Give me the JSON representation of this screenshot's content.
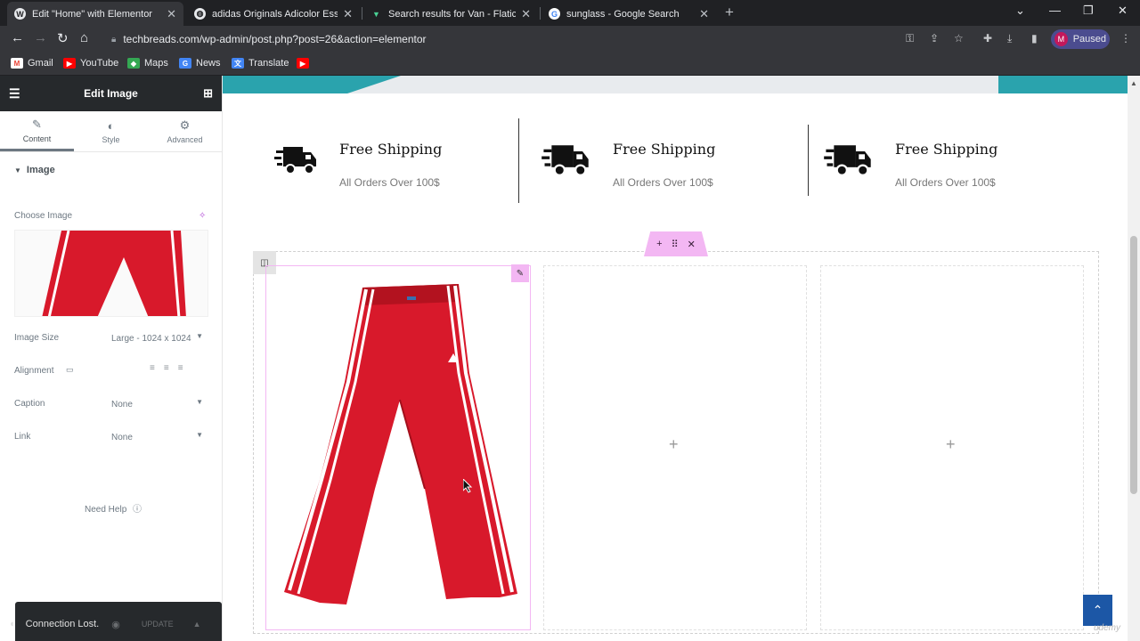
{
  "browser": {
    "tabs": [
      {
        "title": "Edit \"Home\" with Elementor",
        "active": true
      },
      {
        "title": "adidas Originals Adicolor Essenti",
        "active": false
      },
      {
        "title": "Search results for Van - Flaticon",
        "active": false
      },
      {
        "title": "sunglass - Google Search",
        "active": false
      }
    ],
    "new_tab": "+",
    "url": "techbreads.com/wp-admin/post.php?post=26&action=elementor",
    "profile_initial": "M",
    "profile_status": "Paused",
    "bookmarks": [
      "Gmail",
      "YouTube",
      "Maps",
      "News",
      "Translate"
    ]
  },
  "panel": {
    "title": "Edit Image",
    "tabs": [
      {
        "label": "Content",
        "icon": "pencil-icon",
        "active": true
      },
      {
        "label": "Style",
        "icon": "contrast-icon",
        "active": false
      },
      {
        "label": "Advanced",
        "icon": "gear-icon",
        "active": false
      }
    ],
    "section": "Image",
    "choose_image_label": "Choose Image",
    "image_size_label": "Image Size",
    "image_size_value": "Large - 1024 x 1024",
    "alignment_label": "Alignment",
    "caption_label": "Caption",
    "caption_value": "None",
    "link_label": "Link",
    "link_value": "None",
    "need_help": "Need Help",
    "footer": {
      "status": "Connection Lost.",
      "update_label": "UPDATE"
    }
  },
  "canvas": {
    "features": [
      {
        "title": "Free Shipping",
        "subtitle": "All Orders Over 100$"
      },
      {
        "title": "Free Shipping",
        "subtitle": "All Orders Over 100$"
      },
      {
        "title": "Free Shipping",
        "subtitle": "All Orders Over 100$"
      }
    ],
    "add_widget": "+",
    "watermark": "udemy"
  },
  "colors": {
    "chrome_dark": "#202124",
    "chrome_bar": "#35363a",
    "elementor_dark": "#26292c",
    "elementor_pink": "#f3b7f3",
    "teal_accent": "#2aa3ad",
    "pants_red": "#d8192b",
    "back_to_top": "#1c57a6"
  }
}
